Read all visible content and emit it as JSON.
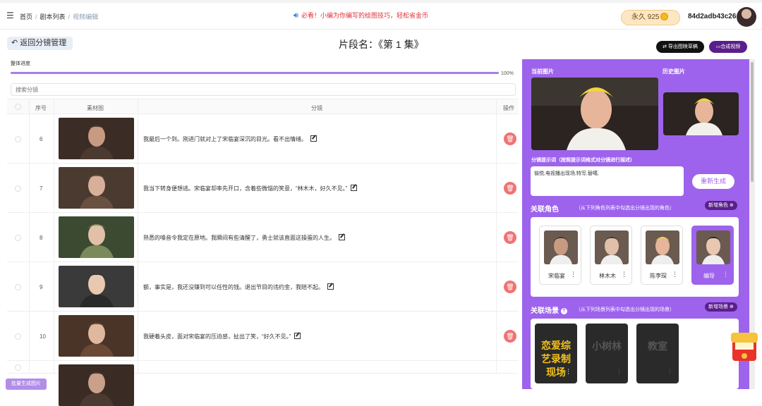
{
  "nav": {
    "breadcrumb": [
      "首页",
      "剧本列表",
      "视频编辑"
    ],
    "notice": "必看！小编为你编写的绘图技巧，轻松省金币",
    "vip_label": "永久 925",
    "username": "84d2adb43c26"
  },
  "header": {
    "back_label": "返回分镜管理",
    "title": "片段名：《第 1 集》",
    "export_label": "导出图映草稿",
    "compose_label": "合成视频"
  },
  "progress": {
    "label": "整体进度",
    "value": 100,
    "text": "100%"
  },
  "search": {
    "placeholder": "搜索分镜"
  },
  "table": {
    "columns": [
      "序号",
      "素材图",
      "分镜",
      "操作"
    ],
    "rows": [
      {
        "index": "6",
        "text": "我最后一个到。刚进门就对上了宋临宴深沉的目光。看不出情绪。"
      },
      {
        "index": "7",
        "text": "我当下转身便想逃。宋临宴却率先开口，含着些微惱的笑意，“林木木，好久不见。”"
      },
      {
        "index": "8",
        "text": "熟悉的嗓音令我定在原地。我瞬间有些清醒了，勇士就该直面这操蛋的人生。"
      },
      {
        "index": "9",
        "text": "额，事实是，我还没赚到可以任性的钱。退出节目的违约金，我赔不起。"
      },
      {
        "index": "10",
        "text": "我硬着头皮，面对宋临宴的压迫感，扯出了笑，“好久不见。”"
      },
      {
        "index": "",
        "text": ""
      }
    ],
    "delete_icon": "trash-icon"
  },
  "batch_label": "批量生成图片",
  "panel": {
    "current_label": "当前图片",
    "history_label": "历史图片",
    "prompt_label": "分镜提示词（按照提示词格式对分镜进行描述）",
    "prompt_value": "愉悦,电视播出现场,特写,替噶,",
    "regen_label": "重新生成",
    "roles_title": "关联角色",
    "roles_hint": "（从下列角色列表中勾选出分镜出现的角色）",
    "new_role": "新增角色",
    "roles": [
      {
        "name": "宋临宴",
        "selected": false
      },
      {
        "name": "林木木",
        "selected": false
      },
      {
        "name": "陈李琛",
        "selected": false
      },
      {
        "name": "编导",
        "selected": true
      }
    ],
    "scenes_title": "关联场景",
    "scenes_hint": "（从下列场景列表中勾选出分镜出现的场景）",
    "new_scene": "新增场景",
    "scenes": [
      {
        "name": "恋爱综艺录制现场"
      },
      {
        "name": "小树林"
      },
      {
        "name": "教室"
      }
    ]
  },
  "colors": {
    "accent": "#9e63ec",
    "dark_purple": "#5a1f8a",
    "danger": "#f07373",
    "notice": "#e0303a"
  }
}
